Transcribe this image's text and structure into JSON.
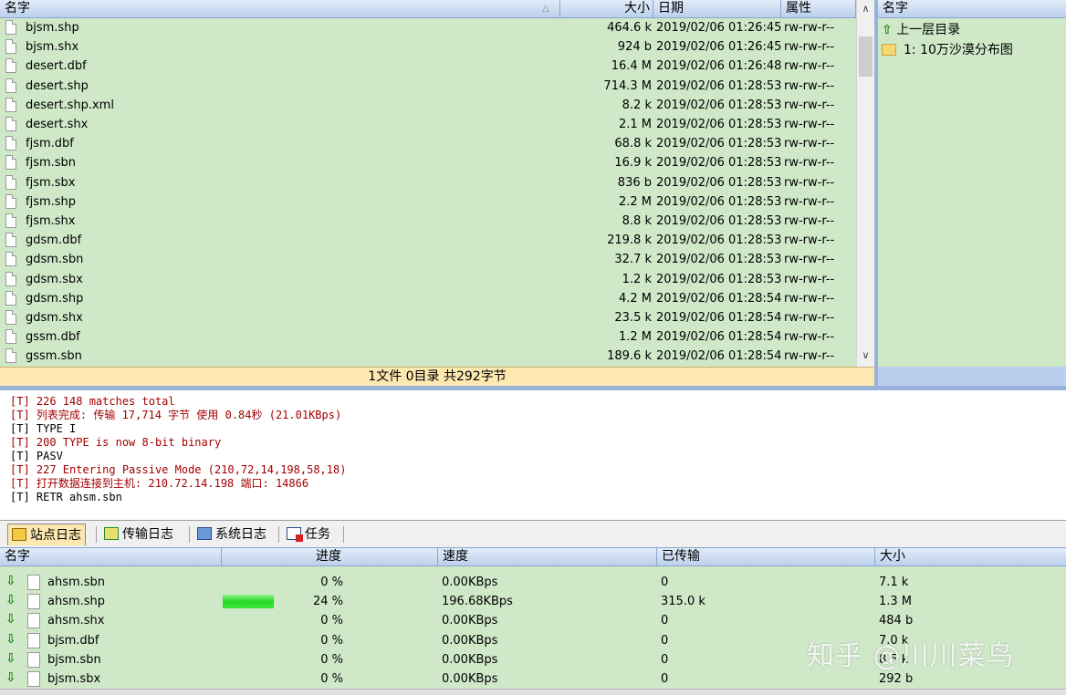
{
  "remote_list": {
    "columns": {
      "name": "名字",
      "size": "大小",
      "date": "日期",
      "attr": "属性"
    },
    "files": [
      {
        "name": "bjsm.shp",
        "size": "464.6 k",
        "date": "2019/02/06 01:26:45",
        "attr": "rw-rw-r--"
      },
      {
        "name": "bjsm.shx",
        "size": "924 b",
        "date": "2019/02/06 01:26:45",
        "attr": "rw-rw-r--"
      },
      {
        "name": "desert.dbf",
        "size": "16.4 M",
        "date": "2019/02/06 01:26:48",
        "attr": "rw-rw-r--"
      },
      {
        "name": "desert.shp",
        "size": "714.3 M",
        "date": "2019/02/06 01:28:53",
        "attr": "rw-rw-r--"
      },
      {
        "name": "desert.shp.xml",
        "size": "8.2 k",
        "date": "2019/02/06 01:28:53",
        "attr": "rw-rw-r--"
      },
      {
        "name": "desert.shx",
        "size": "2.1 M",
        "date": "2019/02/06 01:28:53",
        "attr": "rw-rw-r--"
      },
      {
        "name": "fjsm.dbf",
        "size": "68.8 k",
        "date": "2019/02/06 01:28:53",
        "attr": "rw-rw-r--"
      },
      {
        "name": "fjsm.sbn",
        "size": "16.9 k",
        "date": "2019/02/06 01:28:53",
        "attr": "rw-rw-r--"
      },
      {
        "name": "fjsm.sbx",
        "size": "836 b",
        "date": "2019/02/06 01:28:53",
        "attr": "rw-rw-r--"
      },
      {
        "name": "fjsm.shp",
        "size": "2.2 M",
        "date": "2019/02/06 01:28:53",
        "attr": "rw-rw-r--"
      },
      {
        "name": "fjsm.shx",
        "size": "8.8 k",
        "date": "2019/02/06 01:28:53",
        "attr": "rw-rw-r--"
      },
      {
        "name": "gdsm.dbf",
        "size": "219.8 k",
        "date": "2019/02/06 01:28:53",
        "attr": "rw-rw-r--"
      },
      {
        "name": "gdsm.sbn",
        "size": "32.7 k",
        "date": "2019/02/06 01:28:53",
        "attr": "rw-rw-r--"
      },
      {
        "name": "gdsm.sbx",
        "size": "1.2 k",
        "date": "2019/02/06 01:28:53",
        "attr": "rw-rw-r--"
      },
      {
        "name": "gdsm.shp",
        "size": "4.2 M",
        "date": "2019/02/06 01:28:54",
        "attr": "rw-rw-r--"
      },
      {
        "name": "gdsm.shx",
        "size": "23.5 k",
        "date": "2019/02/06 01:28:54",
        "attr": "rw-rw-r--"
      },
      {
        "name": "gssm.dbf",
        "size": "1.2 M",
        "date": "2019/02/06 01:28:54",
        "attr": "rw-rw-r--"
      },
      {
        "name": "gssm.sbn",
        "size": "189.6 k",
        "date": "2019/02/06 01:28:54",
        "attr": "rw-rw-r--"
      }
    ],
    "status": "1文件 0目录 共292字节"
  },
  "local_tree": {
    "column": "名字",
    "items": [
      {
        "label": "上一层目录",
        "icon": "up-arrow-icon"
      },
      {
        "label": "1:  10万沙漠分布图",
        "icon": "folder-icon"
      }
    ]
  },
  "log": [
    {
      "text": "[T] 226 148 matches total",
      "color": "red"
    },
    {
      "text": "[T] 列表完成: 传输 17,714 字节 使用 0.84秒 (21.01KBps)",
      "color": "red"
    },
    {
      "text": "[T] TYPE I",
      "color": "black"
    },
    {
      "text": "[T] 200 TYPE is now 8-bit binary",
      "color": "red"
    },
    {
      "text": "[T] PASV",
      "color": "black"
    },
    {
      "text": "[T] 227 Entering Passive Mode (210,72,14,198,58,18)",
      "color": "red"
    },
    {
      "text": "[T] 打开数据连接到主机: 210.72.14.198 端口: 14866",
      "color": "red"
    },
    {
      "text": "[T] RETR ahsm.sbn",
      "color": "black"
    }
  ],
  "tabs": [
    {
      "label": "站点日志",
      "icon": "site-log-icon",
      "active": true
    },
    {
      "label": "传输日志",
      "icon": "transfer-log-icon",
      "active": false
    },
    {
      "label": "系统日志",
      "icon": "system-log-icon",
      "active": false
    },
    {
      "label": "任务",
      "icon": "task-icon",
      "active": false
    }
  ],
  "transfer": {
    "columns": {
      "name": "名字",
      "progress": "进度",
      "speed": "速度",
      "transferred": "已传输",
      "size": "大小"
    },
    "rows": [
      {
        "name": "ahsm.sbn",
        "progress": "0 %",
        "progress_value": 0,
        "speed": "0.00KBps",
        "transferred": "0",
        "size": "7.1 k"
      },
      {
        "name": "ahsm.shp",
        "progress": "24 %",
        "progress_value": 24,
        "speed": "196.68KBps",
        "transferred": "315.0 k",
        "size": "1.3 M"
      },
      {
        "name": "ahsm.shx",
        "progress": "0 %",
        "progress_value": 0,
        "speed": "0.00KBps",
        "transferred": "0",
        "size": "484 b"
      },
      {
        "name": "bjsm.dbf",
        "progress": "0 %",
        "progress_value": 0,
        "speed": "0.00KBps",
        "transferred": "0",
        "size": "7.0 k"
      },
      {
        "name": "bjsm.sbn",
        "progress": "0 %",
        "progress_value": 0,
        "speed": "0.00KBps",
        "transferred": "0",
        "size": "8.5 k"
      },
      {
        "name": "bjsm.sbx",
        "progress": "0 %",
        "progress_value": 0,
        "speed": "0.00KBps",
        "transferred": "0",
        "size": "292 b"
      }
    ]
  },
  "watermark": "知乎 @川川菜鸟",
  "colors": {
    "pane_bg": "#cfe8c8",
    "status_bg": "#fde8b0",
    "header_bg": "#bcd0ec",
    "log_red": "#a40000",
    "progress_green": "#22d822"
  }
}
